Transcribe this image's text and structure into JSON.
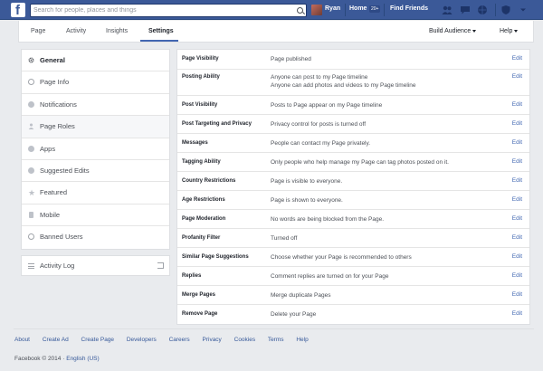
{
  "topbar": {
    "logo": "f",
    "search_placeholder": "Search for people, places and things",
    "user_name": "Ryan",
    "home_label": "Home",
    "home_badge": "20+",
    "find_friends_label": "Find Friends"
  },
  "page_nav": {
    "tabs": [
      {
        "label": "Page"
      },
      {
        "label": "Activity"
      },
      {
        "label": "Insights"
      },
      {
        "label": "Settings"
      }
    ],
    "build_audience_label": "Build Audience",
    "help_label": "Help"
  },
  "sidebar": {
    "items": [
      {
        "label": "General",
        "icon": "gear-icon"
      },
      {
        "label": "Page Info",
        "icon": "info-icon"
      },
      {
        "label": "Notifications",
        "icon": "globe-icon"
      },
      {
        "label": "Page Roles",
        "icon": "person-icon"
      },
      {
        "label": "Apps",
        "icon": "apps-icon"
      },
      {
        "label": "Suggested Edits",
        "icon": "bulb-icon"
      },
      {
        "label": "Featured",
        "icon": "star-icon"
      },
      {
        "label": "Mobile",
        "icon": "mobile-icon"
      },
      {
        "label": "Banned Users",
        "icon": "ban-icon"
      }
    ],
    "activity_log_label": "Activity Log"
  },
  "settings": {
    "edit_label": "Edit",
    "rows": [
      {
        "label": "Page Visibility",
        "value": "Page published"
      },
      {
        "label": "Posting Ability",
        "value": "Anyone can post to my Page timeline",
        "value2": "Anyone can add photos and videos to my Page timeline"
      },
      {
        "label": "Post Visibility",
        "value": "Posts to Page appear on my Page timeline"
      },
      {
        "label": "Post Targeting and Privacy",
        "value": "Privacy control for posts is turned off"
      },
      {
        "label": "Messages",
        "value": "People can contact my Page privately."
      },
      {
        "label": "Tagging Ability",
        "value": "Only people who help manage my Page can tag photos posted on it."
      },
      {
        "label": "Country Restrictions",
        "value": "Page is visible to everyone."
      },
      {
        "label": "Age Restrictions",
        "value": "Page is shown to everyone."
      },
      {
        "label": "Page Moderation",
        "value": "No words are being blocked from the Page."
      },
      {
        "label": "Profanity Filter",
        "value": "Turned off"
      },
      {
        "label": "Similar Page Suggestions",
        "value": "Choose whether your Page is recommended to others"
      },
      {
        "label": "Replies",
        "value": "Comment replies are turned on for your Page"
      },
      {
        "label": "Merge Pages",
        "value": "Merge duplicate Pages"
      },
      {
        "label": "Remove Page",
        "value": "Delete your Page"
      }
    ]
  },
  "footer": {
    "links": [
      "About",
      "Create Ad",
      "Create Page",
      "Developers",
      "Careers",
      "Privacy",
      "Cookies",
      "Terms",
      "Help"
    ],
    "copyright": "Facebook © 2014 ·",
    "language": "English (US)"
  },
  "colors": {
    "brand_blue": "#3b5998",
    "link_blue": "#4267b2",
    "background": "#e9ebee"
  }
}
